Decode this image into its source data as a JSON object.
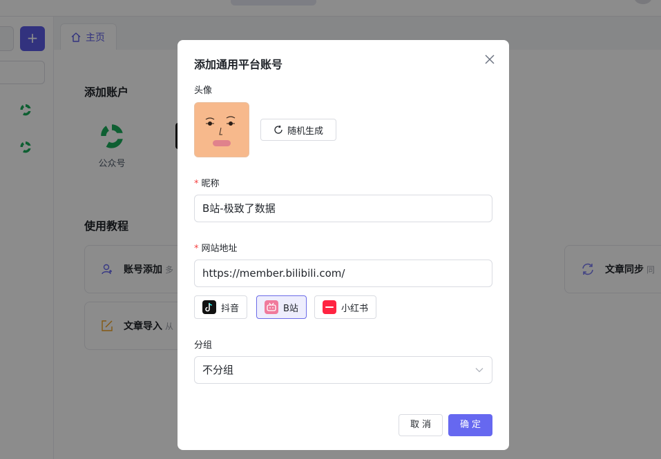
{
  "background": {
    "tab_home": "主页",
    "add_account_title": "添加账户",
    "accounts": [
      {
        "label": "公众号"
      }
    ],
    "tutorial_title": "使用教程",
    "tutorials": [
      {
        "label": "账号添加",
        "sub": "多"
      },
      {
        "label": "文章同步",
        "sub": "同"
      },
      {
        "label": "文章导入",
        "sub": "从"
      }
    ]
  },
  "modal": {
    "title": "添加通用平台账号",
    "avatar_label": "头像",
    "random_button": "随机生成",
    "nickname_label": "昵称",
    "nickname_value": "B站-极致了数据",
    "url_label": "网站地址",
    "url_value": "https://member.bilibili.com/",
    "platforms": [
      {
        "label": "抖音",
        "icon": "douyin-icon",
        "color": "#111111"
      },
      {
        "label": "B站",
        "icon": "bilibili-icon",
        "color": "#f07a9c"
      },
      {
        "label": "小红书",
        "icon": "xiaohongshu-icon",
        "color": "#ff2442"
      }
    ],
    "selected_platform": "B站",
    "group_label": "分组",
    "group_value": "不分组",
    "cancel_button": "取消",
    "ok_button": "确定",
    "required_mark": "*"
  },
  "colors": {
    "accent": "#5b5ce6",
    "primary_button": "#6668f0",
    "required": "#f53f3f",
    "avatar_bg": "#f7b98c"
  }
}
